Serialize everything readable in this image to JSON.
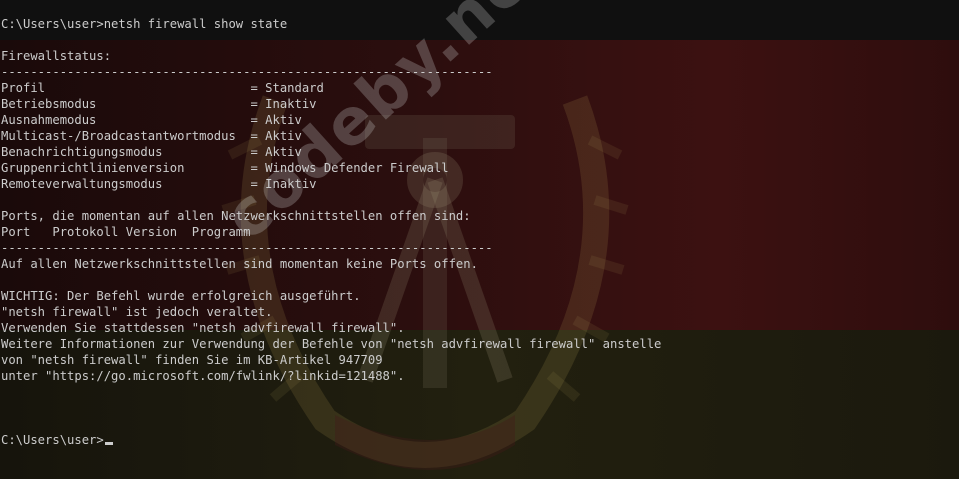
{
  "terminal": {
    "lines": [
      "C:\\Users\\user>netsh firewall show state",
      "",
      "Firewallstatus:",
      "-------------------------------------------------------------------",
      "Profil                            = Standard",
      "Betriebsmodus                     = Inaktiv",
      "Ausnahmemodus                     = Aktiv",
      "Multicast-/Broadcastantwortmodus  = Aktiv",
      "Benachrichtigungsmodus            = Aktiv",
      "Gruppenrichtlinienversion         = Windows Defender Firewall",
      "Remoteverwaltungsmodus            = Inaktiv",
      "",
      "Ports, die momentan auf allen Netzwerkschnittstellen offen sind:",
      "Port   Protokoll Version  Programm",
      "-------------------------------------------------------------------",
      "Auf allen Netzwerkschnittstellen sind momentan keine Ports offen.",
      "",
      "WICHTIG: Der Befehl wurde erfolgreich ausgeführt.",
      "\"netsh firewall\" ist jedoch veraltet.",
      "Verwenden Sie stattdessen \"netsh advfirewall firewall\".",
      "Weitere Informationen zur Verwendung der Befehle von \"netsh advfirewall firewall\" anstelle",
      "von \"netsh firewall\" finden Sie im KB-Artikel 947709",
      "unter \"https://go.microsoft.com/fwlink/?linkid=121488\".",
      "",
      "",
      "",
      "C:\\Users\\user>"
    ]
  },
  "watermark": "codeby.net",
  "colors": {
    "text": "#cccccc",
    "background": "#0c0c0c",
    "flag_red": "#3c1111",
    "flag_gold": "#22200f"
  },
  "icons": [
    "gdr-emblem-icon"
  ]
}
